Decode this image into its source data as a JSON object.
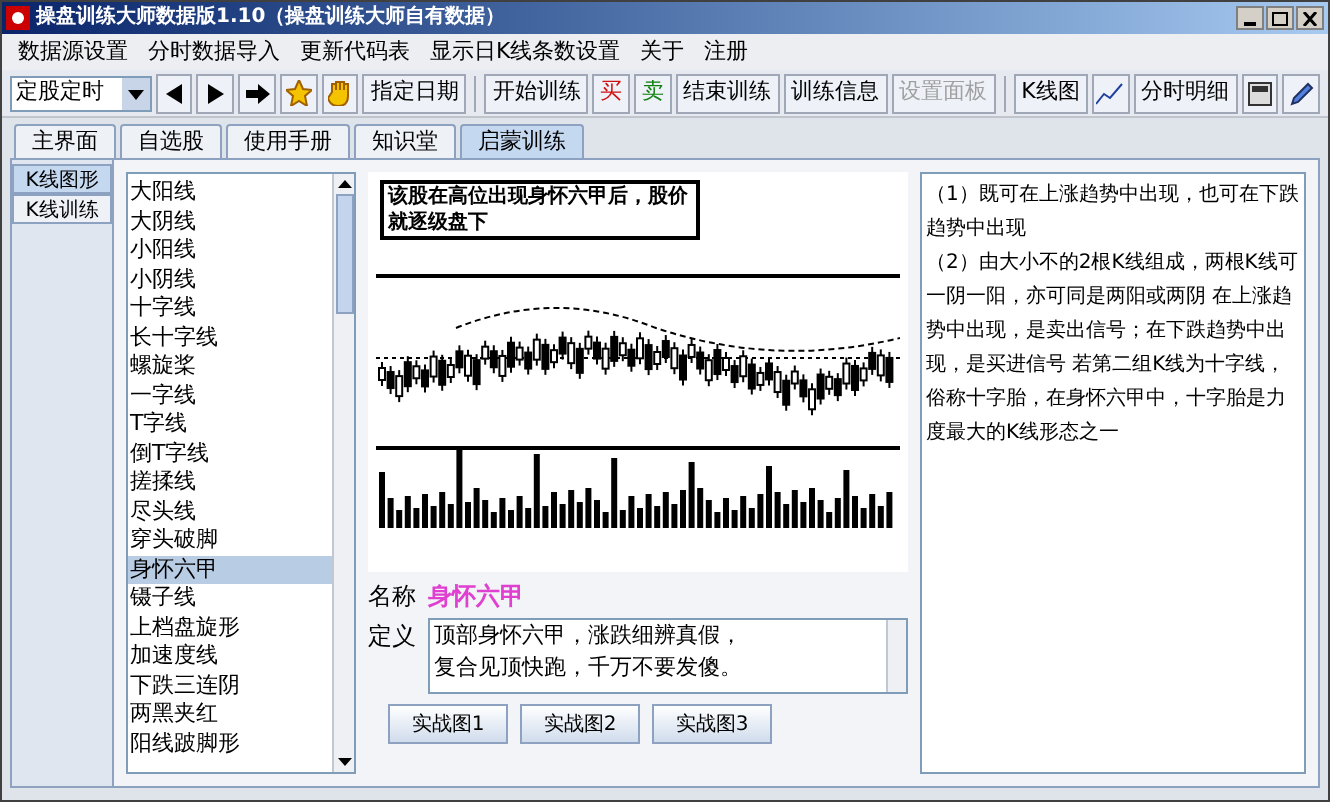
{
  "window": {
    "title": "操盘训练大师数据版1.10（操盘训练大师自有数据）"
  },
  "menu": [
    "数据源设置",
    "分时数据导入",
    "更新代码表",
    "显示日K线条数设置",
    "关于",
    "注册"
  ],
  "toolbar": {
    "dropdown": {
      "value": "定股定时"
    },
    "items": [
      {
        "kind": "prev"
      },
      {
        "kind": "next"
      },
      {
        "kind": "forward"
      },
      {
        "kind": "star"
      },
      {
        "kind": "hand"
      },
      {
        "kind": "text",
        "label": "指定日期",
        "disabled": false
      },
      {
        "kind": "sep"
      },
      {
        "kind": "text",
        "label": "开始训练",
        "disabled": false
      },
      {
        "kind": "trade",
        "label": "买",
        "color": "#d01010"
      },
      {
        "kind": "trade",
        "label": "卖",
        "color": "#108010"
      },
      {
        "kind": "text",
        "label": "结束训练",
        "disabled": false
      },
      {
        "kind": "text",
        "label": "训练信息",
        "disabled": false
      },
      {
        "kind": "text",
        "label": "设置面板",
        "disabled": true
      },
      {
        "kind": "sep"
      },
      {
        "kind": "text",
        "label": "K线图",
        "disabled": false
      },
      {
        "kind": "chart"
      },
      {
        "kind": "text",
        "label": "分时明细",
        "disabled": false
      },
      {
        "kind": "calc"
      },
      {
        "kind": "pencil"
      }
    ]
  },
  "tabs": [
    {
      "label": "主界面",
      "selected": false
    },
    {
      "label": "自选股",
      "selected": false
    },
    {
      "label": "使用手册",
      "selected": false
    },
    {
      "label": "知识堂",
      "selected": false
    },
    {
      "label": "启蒙训练",
      "selected": true
    }
  ],
  "side_tabs": [
    {
      "label": "K线图形",
      "selected": true
    },
    {
      "label": "K线训练",
      "selected": false
    }
  ],
  "pattern_list": [
    {
      "label": "大阳线",
      "selected": false
    },
    {
      "label": "大阴线",
      "selected": false
    },
    {
      "label": "小阳线",
      "selected": false
    },
    {
      "label": "小阴线",
      "selected": false
    },
    {
      "label": "十字线",
      "selected": false
    },
    {
      "label": "长十字线",
      "selected": false
    },
    {
      "label": "螺旋桨",
      "selected": false
    },
    {
      "label": "一字线",
      "selected": false
    },
    {
      "label": "T字线",
      "selected": false
    },
    {
      "label": "倒T字线",
      "selected": false
    },
    {
      "label": "搓揉线",
      "selected": false
    },
    {
      "label": "尽头线",
      "selected": false
    },
    {
      "label": "穿头破脚",
      "selected": false
    },
    {
      "label": "身怀六甲",
      "selected": true
    },
    {
      "label": "镊子线",
      "selected": false
    },
    {
      "label": "上档盘旋形",
      "selected": false
    },
    {
      "label": "加速度线",
      "selected": false
    },
    {
      "label": "下跌三连阴",
      "selected": false
    },
    {
      "label": "两黑夹红",
      "selected": false
    },
    {
      "label": "阳线跛脚形",
      "selected": false
    }
  ],
  "chart_image": {
    "caption": "该股在高位出现身怀六甲后，股价就逐级盘下"
  },
  "name": {
    "label": "名称",
    "value": "身怀六甲"
  },
  "definition": {
    "label": "定义",
    "lines": [
      "顶部身怀六甲，涨跌细辨真假，",
      "复合见顶快跑，千万不要发傻。"
    ]
  },
  "example_buttons": [
    "实战图1",
    "实战图2",
    "实战图3"
  ],
  "description": [
    "（1）既可在上涨趋势中出现，也可在下跌趋势中出现",
    "（2）由大小不的2根K线组成，两根K线可一阴一阳，亦可同是两阳或两阴 在上涨趋势中出现，是卖出信号；在下跌趋势中出现，是买进信号 若第二组K线为十字线，俗称十字胎，在身怀六甲中，十字胎是力度最大的K线形态之一"
  ]
}
